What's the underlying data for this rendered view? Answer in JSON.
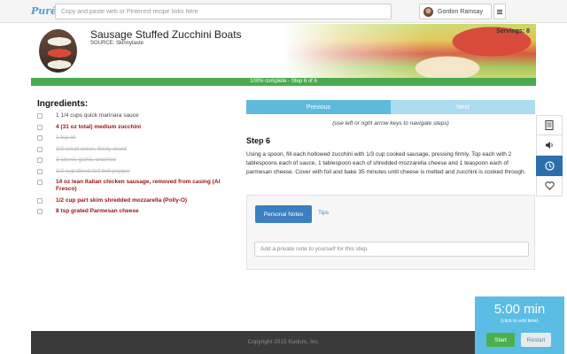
{
  "topbar": {
    "logo": "Purée",
    "search_placeholder": "Copy and paste web or Pinterest recipe links here",
    "user_name": "Gordon Ramsay",
    "menu_icon": "hamburger-icon"
  },
  "recipe": {
    "title": "Sausage Stuffed Zucchini Boats",
    "source": "SOURCE: Skinnytaste",
    "servings": "Servings: 8"
  },
  "progress": {
    "fraction": 1.0,
    "label": "100% complete - Step 6 of 6"
  },
  "ingredients": {
    "title": "Ingredients:",
    "items": [
      {
        "text": "1 1/4 cups quick marinara sauce",
        "state": "normal"
      },
      {
        "text": "4 (31 oz total) medium zucchini",
        "state": "highlight"
      },
      {
        "text": "1 tsp oil",
        "state": "done"
      },
      {
        "text": "1/2 small onion, finely diced",
        "state": "done"
      },
      {
        "text": "3 cloves garlic, crushed",
        "state": "done"
      },
      {
        "text": "1/2 cup diced red bell pepper",
        "state": "done"
      },
      {
        "text": "14 oz lean Italian chicken sausage, removed from casing (Al Fresco)",
        "state": "highlight"
      },
      {
        "text": "1/2 cup part skim shredded mozzarella (Polly-O)",
        "state": "highlight"
      },
      {
        "text": "8 tsp grated Parmesan cheese",
        "state": "highlight"
      }
    ]
  },
  "step": {
    "prev_label": "Previous",
    "next_label": "Next",
    "hint": "(use left or right arrow keys to navigate steps)",
    "title": "Step 6",
    "body": "Using a spoon, fill each hollowed zucchini with 1/3 cup cooked sausage, pressing firmly. Top each with 2 tablespoons each of sauce, 1 tablespoon each of shredded mozzarella cheese and 1 teaspoon each of parmesan cheese. Cover with foil and bake 35 minutes until cheese is melted and zucchini is cooked through."
  },
  "notes": {
    "tab_notes": "Personal Notes",
    "tab_tips": "Tips",
    "placeholder": "Add a private note to yourself for this step."
  },
  "side_tools": [
    "recipe-icon",
    "speaker-icon",
    "clock-icon",
    "heart-icon"
  ],
  "footer": {
    "copyright": "Copyright 2015 Kuduro, Inc."
  },
  "timer": {
    "time": "5:00 min",
    "hint": "(click to edit time)",
    "start_label": "Start",
    "restart_label": "Restart"
  },
  "colors": {
    "accent": "#5fb9dd",
    "primary": "#3c7fc0",
    "progress": "#4aaa4e",
    "highlight_text": "#9a1111"
  }
}
